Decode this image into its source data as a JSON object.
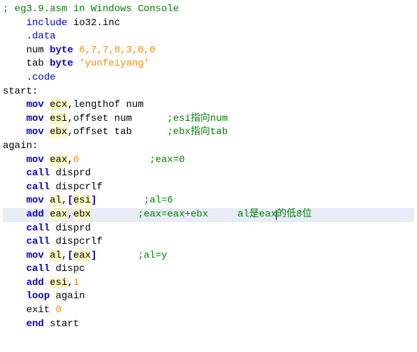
{
  "code": {
    "l0": {
      "comment": "; eg3.9.asm in Windows Console"
    },
    "l1": {
      "indent": "    ",
      "directive": "include",
      "arg": " io32.inc"
    },
    "l2": {
      "indent": "    ",
      "directive": ".data"
    },
    "l3": {
      "indent": "    ",
      "name": "num ",
      "kw": "byte",
      "vals": " 6,7,7,8,3,0,0"
    },
    "l4": {
      "indent": "    ",
      "name": "tab ",
      "kw": "byte",
      "str": " 'yunfeiyang'"
    },
    "l5": {
      "indent": "    ",
      "directive": ".code"
    },
    "l6": {
      "label": "start:"
    },
    "l7": {
      "indent": "    ",
      "kw": "mov",
      "sp": " ",
      "r1": "ecx",
      "c": ",",
      "arg": "lengthof num"
    },
    "l8": {
      "indent": "    ",
      "kw": "mov",
      "sp": " ",
      "r1": "esi",
      "c": ",",
      "arg": "offset num",
      "pad": "      ",
      "comment": ";esi指向num"
    },
    "l9": {
      "indent": "    ",
      "kw": "mov",
      "sp": " ",
      "r1": "ebx",
      "c": ",",
      "arg": "offset tab",
      "pad": "      ",
      "comment": ";ebx指向tab"
    },
    "l10": {
      "label": "again:"
    },
    "l11": {
      "indent": "    ",
      "kw": "mov",
      "sp": " ",
      "r1": "eax",
      "c": ",",
      "num": "0",
      "pad": "            ",
      "comment": ";eax=0"
    },
    "l12": {
      "indent": "    ",
      "kw": "call",
      "arg": " disprd"
    },
    "l13": {
      "indent": "    ",
      "kw": "call",
      "arg": " dispcrlf"
    },
    "l14": {
      "indent": "    ",
      "kw": "mov",
      "sp": " ",
      "r1": "al",
      "c": ",",
      "lb": "[",
      "r2": "esi",
      "rb": "]",
      "pad": "        ",
      "comment": ";al=6"
    },
    "l15": {
      "indent": "    ",
      "kw": "add",
      "sp": " ",
      "r1": "eax",
      "c": ",",
      "r2": "ebx",
      "pad": "        ",
      "comment": ";eax=eax+ebx     al是eax",
      "comment2": "的低8位"
    },
    "l16": {
      "indent": "    ",
      "kw": "call",
      "arg": " disprd"
    },
    "l17": {
      "indent": "    ",
      "kw": "call",
      "arg": " dispcrlf"
    },
    "l18": {
      "indent": "    ",
      "kw": "mov",
      "sp": " ",
      "r1": "al",
      "c": ",",
      "lb": "[",
      "r2": "eax",
      "rb": "]",
      "pad": "       ",
      "comment": ";al=y"
    },
    "l19": {
      "indent": "    ",
      "kw": "call",
      "arg": " dispc"
    },
    "l20": {
      "indent": "    ",
      "kw": "add",
      "sp": " ",
      "r1": "esi",
      "c": ",",
      "num": "1"
    },
    "l21": {
      "indent": "    ",
      "kw": "loop",
      "arg": " again"
    },
    "l22": {
      "indent": "    ",
      "id": "exit ",
      "num": "0"
    },
    "l23": {
      "indent": "    ",
      "kw": "end",
      "arg": " start"
    }
  }
}
